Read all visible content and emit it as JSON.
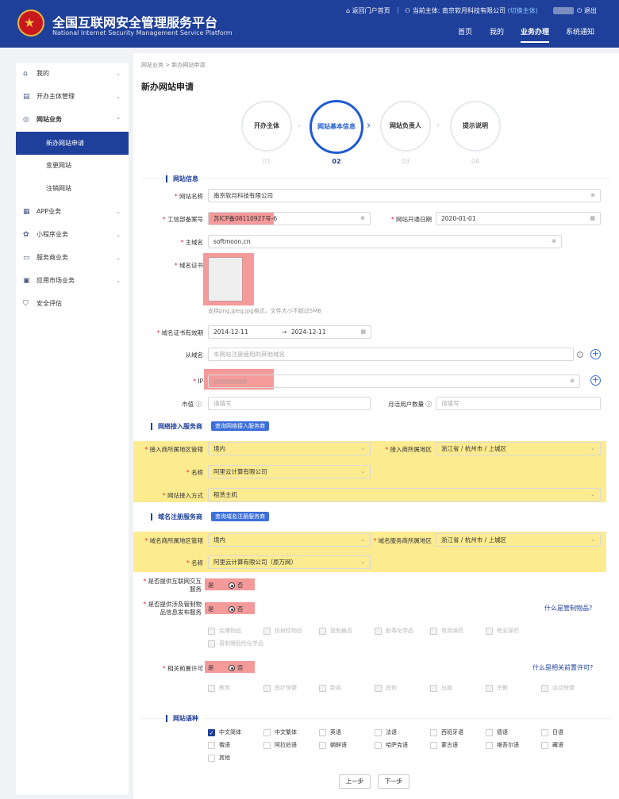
{
  "header": {
    "title": "全国互联网安全管理服务平台",
    "subtitle": "National Internet Security Management Service Platform",
    "portal_link": "返回门户首页",
    "subject_prefix": "当前主体:",
    "subject_name": "南京软月科技有限公司",
    "switch_link": "(切换主体)",
    "logout": "退出",
    "nav": [
      "首页",
      "我的",
      "业务办理",
      "系统通知"
    ]
  },
  "sidebar": {
    "items": [
      {
        "label": "我的",
        "icon": "home-icon"
      },
      {
        "label": "开办主体管理",
        "icon": "entity-icon"
      },
      {
        "label": "网站业务",
        "icon": "globe-icon"
      },
      {
        "label": "新办网站申请"
      },
      {
        "label": "变更网站"
      },
      {
        "label": "注销网站"
      },
      {
        "label": "APP业务",
        "icon": "grid-icon"
      },
      {
        "label": "小程序业务",
        "icon": "miniapp-icon"
      },
      {
        "label": "服务商业务",
        "icon": "service-icon"
      },
      {
        "label": "应用市场业务",
        "icon": "market-icon"
      },
      {
        "label": "安全评估",
        "icon": "shield-icon"
      }
    ]
  },
  "breadcrumb": {
    "root": "网站业务",
    "sep": ">",
    "current": "新办网站申请"
  },
  "page_title": "新办网站申请",
  "steps": [
    {
      "label": "开办主体",
      "num": "01"
    },
    {
      "label": "网站基本信息",
      "num": "02"
    },
    {
      "label": "网站负责人",
      "num": "03"
    },
    {
      "label": "提示说明",
      "num": "04"
    }
  ],
  "site_info": {
    "section": "网站信息",
    "name_label": "网站名称",
    "name_value": "南京软月科技有限公司",
    "icp_label": "工信部备案号",
    "icp_value": "苏ICP备08110927号-6",
    "open_date_label": "网站开通日期",
    "open_date_value": "2020-01-01",
    "domain_label": "主域名",
    "domain_value": "softmoon.cn",
    "cert_label": "域名证书",
    "cert_hint": "支持png,jpeg,jpg格式，文件大小不超过5MB",
    "cert_valid_label": "域名证书有效期",
    "cert_start": "2014-12-11",
    "cert_arrow": "→",
    "cert_end": "2024-12-11",
    "sub_domain_label": "从域名",
    "sub_domain_placeholder": "本网站注册使用的其他域名",
    "ip_label": "IP",
    "market_value_label": "市值",
    "market_value_placeholder": "请填写",
    "mau_label": "月活用户数量",
    "mau_placeholder": "请填写"
  },
  "access": {
    "section": "网络接入服务商",
    "query_btn": "查询网络接入服务商",
    "region_label": "接入商所属地区管辖",
    "region_value": "境内",
    "area_label": "接入商所属地区",
    "area_value": "浙江省 / 杭州市 / 上城区",
    "name_label": "名称",
    "name_value": "阿里云计算有限公司",
    "method_label": "网站接入方式",
    "method_value": "租赁主机"
  },
  "registrar": {
    "section": "域名注册服务商",
    "query_btn": "查询域名注册服务商",
    "region_label": "域名商所属地区管辖",
    "region_value": "境内",
    "area_label": "域名服务商所属地区",
    "area_value": "浙江省 / 杭州市 / 上城区",
    "name_label": "名称",
    "name_value": "阿里云计算有限公司（原万网）"
  },
  "questions": {
    "interactive_label": "是否提供互联网交互服务",
    "controlled_label": "是否提供涉及管制物品信息发布服务",
    "controlled_link": "什么是管制物品?",
    "controlled_items": [
      "民爆物品",
      "仿射性物品",
      "管制器具",
      "剧毒化学品",
      "弩用弹药",
      "枪支弹药",
      "易制爆危险化学品"
    ],
    "permit_label": "相关前置许可",
    "permit_link": "什么是相关前置许可?",
    "permit_items": [
      "教育",
      "医疗保健",
      "新闻",
      "其他",
      "出版",
      "宗教",
      "运动保健"
    ],
    "yes": "是",
    "no": "否"
  },
  "language": {
    "section": "网站语种",
    "options": [
      "中文简体",
      "中文繁体",
      "英语",
      "法语",
      "西班牙语",
      "德语",
      "日语",
      "俄语",
      "阿拉伯语",
      "朝鲜语",
      "哈萨克语",
      "蒙古语",
      "维吾尔语",
      "藏语",
      "其他"
    ]
  },
  "footer": {
    "prev": "上一步",
    "next": "下一步"
  },
  "colors": {
    "brand": "#1e3f9a",
    "highlight_yellow": "#fdeb8f",
    "highlight_red": "#f59a9a"
  }
}
